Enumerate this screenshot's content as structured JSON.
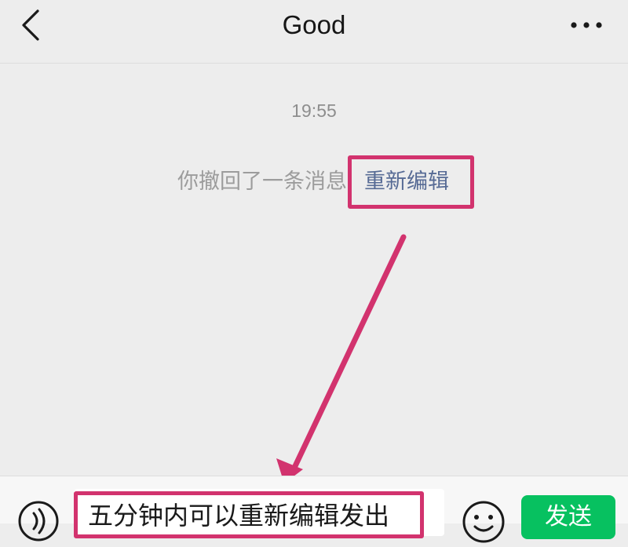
{
  "header": {
    "title": "Good",
    "back_icon": "chevron-left-icon",
    "more_icon": "more-dots-icon"
  },
  "chat": {
    "timestamp": "19:55",
    "recall_notice": "你撤回了一条消息",
    "reedit_label": "重新编辑"
  },
  "input_bar": {
    "voice_icon": "voice-icon",
    "input_value": "五分钟内可以重新编辑发出",
    "emoji_icon": "emoji-icon",
    "send_label": "发送"
  },
  "colors": {
    "background": "#ededed",
    "link": "#576b95",
    "highlight": "#d2336e",
    "send_button": "#07c160"
  }
}
